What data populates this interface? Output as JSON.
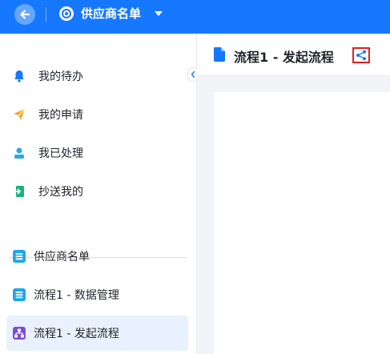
{
  "header": {
    "app_title": "供应商名单"
  },
  "sidebar": {
    "items": [
      {
        "label": "我的待办",
        "icon": "bell-icon"
      },
      {
        "label": "我的申请",
        "icon": "paper-plane-icon"
      },
      {
        "label": "我已处理",
        "icon": "user-stamp-icon"
      },
      {
        "label": "抄送我的",
        "icon": "forward-doc-icon"
      }
    ],
    "forms": [
      {
        "label": "供应商名单",
        "icon": "form-list-icon"
      },
      {
        "label": "流程1 - 数据管理",
        "icon": "form-list-icon"
      },
      {
        "label": "流程1 - 发起流程",
        "icon": "flow-icon",
        "active": true
      }
    ]
  },
  "main": {
    "title": "流程1 - 发起流程"
  },
  "colors": {
    "brand": "#1677ff",
    "active_bg": "#e8f1fd",
    "share_highlight": "#e02020"
  }
}
